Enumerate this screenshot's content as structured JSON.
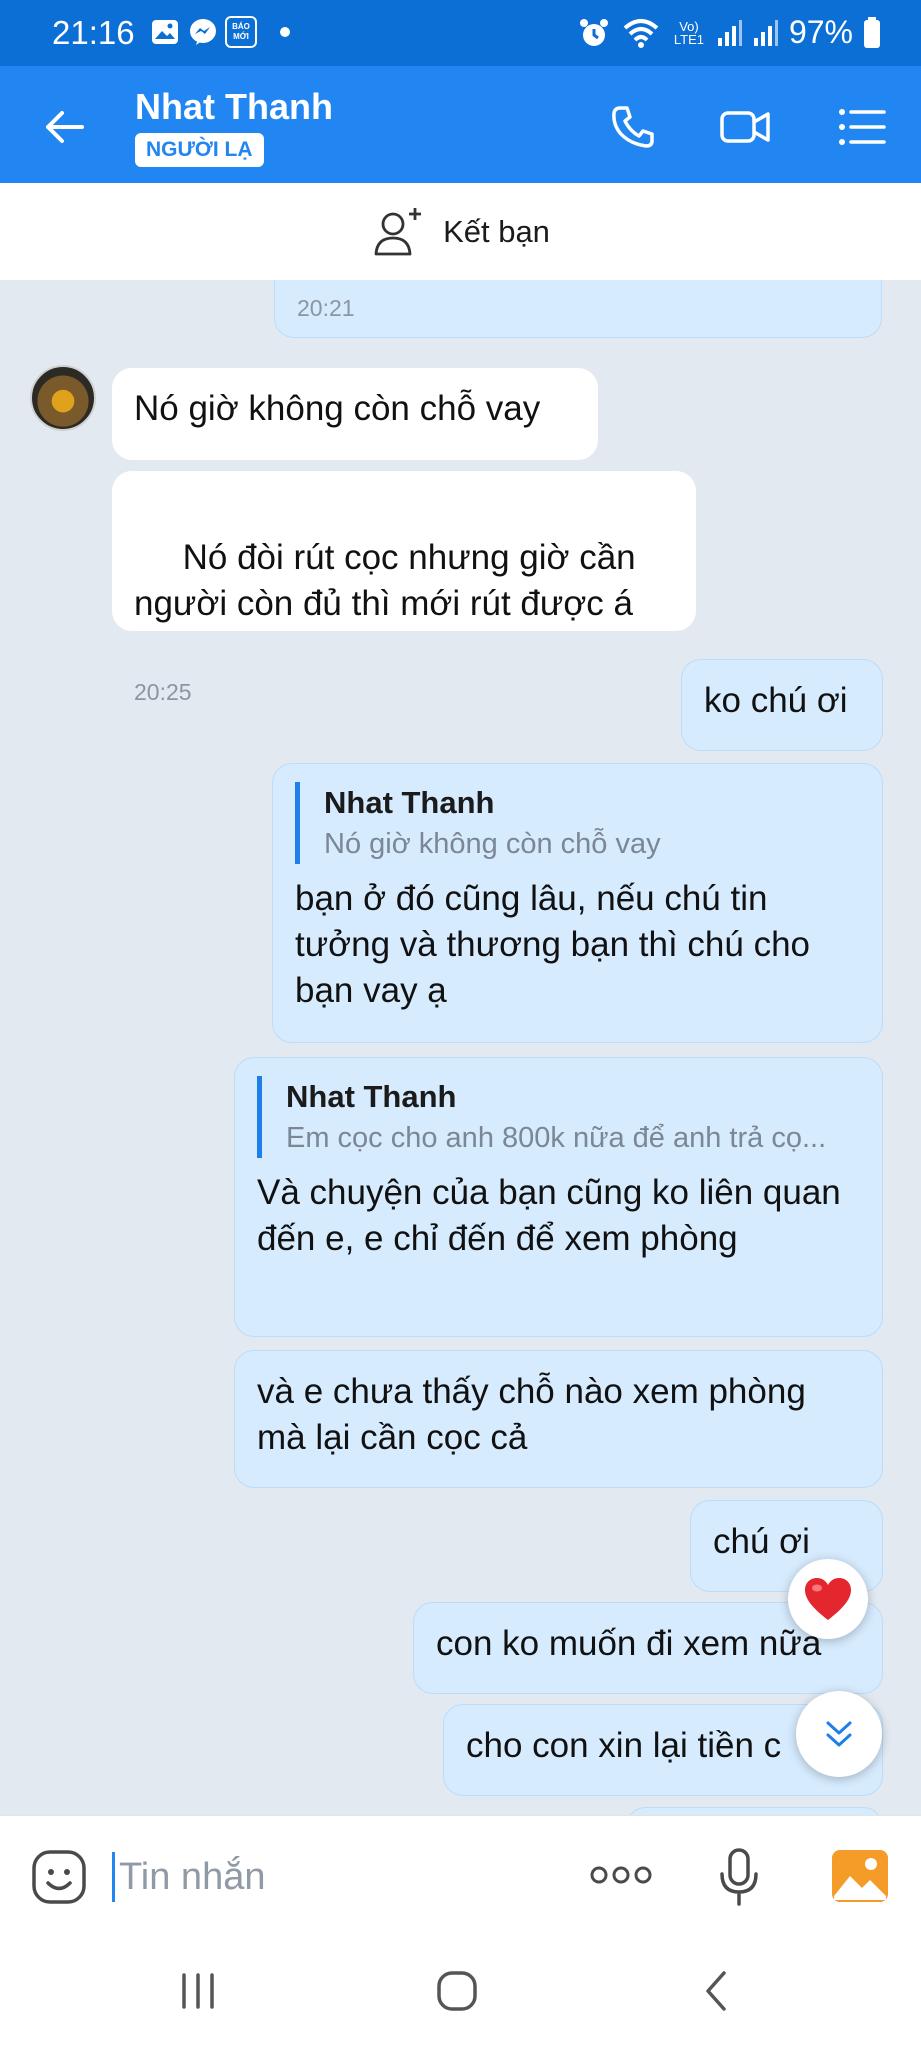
{
  "status_bar": {
    "time": "21:16",
    "battery": "97%",
    "notification_icons": [
      "gallery-icon",
      "messenger-icon",
      "baomoi-icon",
      "dot-icon"
    ],
    "baomoi_text": "BÁO MỚI",
    "network_label": "Vo) LTE1",
    "system_icons": [
      "alarm-icon",
      "wifi-icon",
      "lte-icon",
      "signal-icon",
      "signal-icon",
      "battery-icon"
    ]
  },
  "header": {
    "contact_name": "Nhat Thanh",
    "stranger_badge": "NGƯỜI LẠ",
    "icons": [
      "back-arrow-icon",
      "phone-icon",
      "video-call-icon",
      "menu-list-icon"
    ]
  },
  "add_friend": {
    "label": "Kết bạn",
    "icon": "add-user-icon"
  },
  "messages": [
    {
      "dir": "out",
      "text": "",
      "time": "20:21"
    },
    {
      "dir": "in",
      "text": "Nó giờ không còn chỗ vay",
      "time": ""
    },
    {
      "dir": "in",
      "text": " Nó đòi rút cọc nhưng giờ cần người còn đủ thì mới rút được á",
      "time": "20:25"
    },
    {
      "dir": "out",
      "text": "ko chú ơi",
      "time": ""
    },
    {
      "dir": "out",
      "quote_name": "Nhat Thanh",
      "quote_text": "Nó giờ không còn chỗ vay",
      "text": "bạn ở đó cũng lâu, nếu chú tin tưởng và thương bạn thì chú cho bạn vay ạ",
      "time": ""
    },
    {
      "dir": "out",
      "quote_name": "Nhat Thanh",
      "quote_text": "Em cọc cho anh 800k nữa để anh trả cọ...",
      "text": "Và chuyện của bạn cũng ko liên quan đến e, e chỉ đến để xem phòng",
      "time": ""
    },
    {
      "dir": "out",
      "text": "và e chưa thấy chỗ nào xem phòng mà lại cần cọc cả",
      "time": ""
    },
    {
      "dir": "out",
      "text": "chú ơi",
      "time": ""
    },
    {
      "dir": "out",
      "text": "con ko muốn đi xem nữa",
      "time": ""
    },
    {
      "dir": "out",
      "text": "cho con xin lại tiền c",
      "time": ""
    }
  ],
  "floating": {
    "reaction_icon": "heart-icon",
    "scroll_icon": "scroll-down-chevron-icon"
  },
  "input": {
    "placeholder": "Tin nhắn",
    "icons": [
      "sticker-icon",
      "more-icon",
      "microphone-icon",
      "image-gallery-icon"
    ]
  },
  "nav": {
    "icons": [
      "recent-apps-icon",
      "home-icon",
      "back-icon"
    ]
  },
  "colors": {
    "header": "#2186f2",
    "status": "#0b6fd6",
    "outgoing": "#d6ebfe",
    "incoming": "#ffffff",
    "background": "#e2e9f1"
  }
}
